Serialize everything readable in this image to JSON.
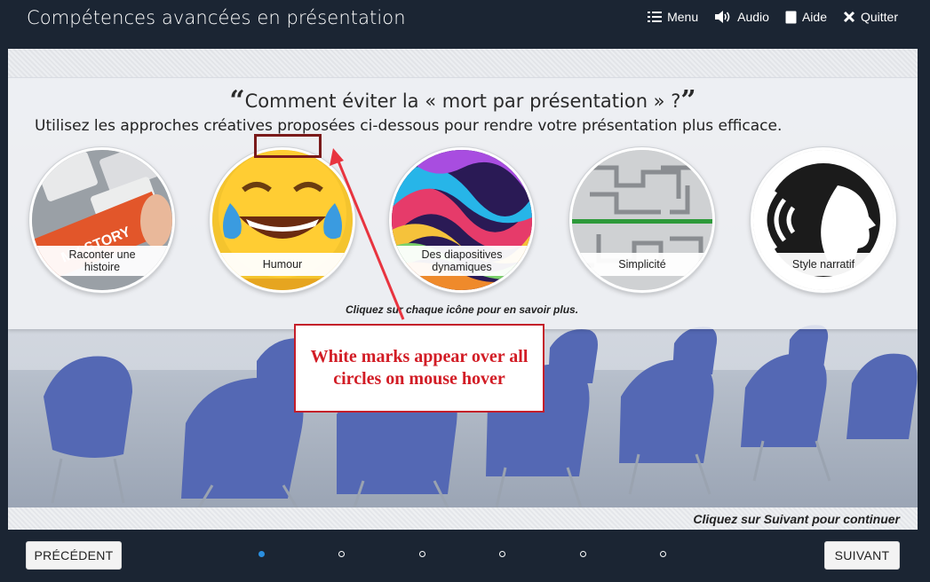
{
  "header": {
    "title": "Compétences avancées en présentation",
    "nav": [
      {
        "label": "Menu",
        "icon": "menu-icon"
      },
      {
        "label": "Audio",
        "icon": "speaker-icon"
      },
      {
        "label": "Aide",
        "icon": "help-document-icon"
      },
      {
        "label": "Quitter",
        "icon": "close-icon"
      }
    ]
  },
  "slide": {
    "question": "Comment éviter la « mort par présentation » ?",
    "quote_open": "“",
    "quote_close": "”",
    "subtitle": "Utilisez les approches créatives proposées ci-dessous pour rendre votre présentation plus efficace.",
    "circles": [
      {
        "line1": "Raconter une",
        "line2": "histoire",
        "image": "keyboard-story-key"
      },
      {
        "line1": "Humour",
        "line2": "",
        "image": "laughing-emoji"
      },
      {
        "line1": "Des diapositives",
        "line2": "dynamiques",
        "image": "colorful-paint-swirl"
      },
      {
        "line1": "Simplicité",
        "line2": "",
        "image": "maze-path"
      },
      {
        "line1": "Style narratif",
        "line2": "",
        "image": "speaking-head-silhouette"
      }
    ],
    "hint": "Cliquez sur chaque icône pour en savoir plus.",
    "continue_hint": "Cliquez sur Suivant pour continuer"
  },
  "annotation": {
    "text_line1": "White marks appear over all",
    "text_line2": "circles on mouse hover",
    "color": "#d21c25"
  },
  "footer": {
    "prev_label": "PRÉCÉDENT",
    "next_label": "SUIVANT",
    "progress": {
      "total": 6,
      "current": 1
    }
  },
  "colors": {
    "chrome": "#1b2533",
    "accent": "#2a8fe0"
  }
}
